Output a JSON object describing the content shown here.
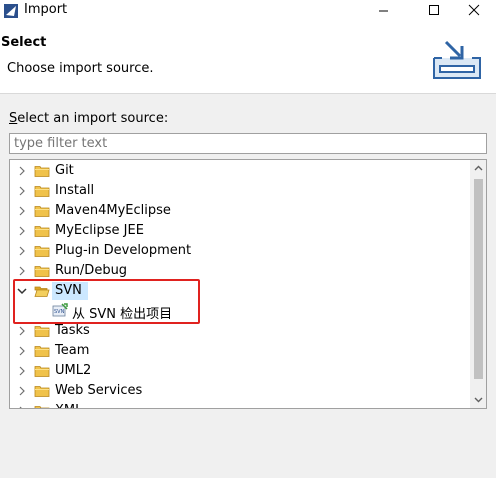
{
  "window": {
    "title": "Import",
    "icon": "eclipse-app-icon"
  },
  "header": {
    "title": "Select",
    "message": "Choose import source.",
    "art_icon": "import-tray-icon"
  },
  "source": {
    "label_prefix": "S",
    "label_rest": "elect an import source:",
    "filter_placeholder": "type filter text"
  },
  "tree": {
    "items": [
      {
        "label": "Git",
        "expanded": false
      },
      {
        "label": "Install",
        "expanded": false
      },
      {
        "label": "Maven4MyEclipse",
        "expanded": false
      },
      {
        "label": "MyEclipse JEE",
        "expanded": false
      },
      {
        "label": "Plug-in Development",
        "expanded": false
      },
      {
        "label": "Run/Debug",
        "expanded": false
      },
      {
        "label": "SVN",
        "expanded": true,
        "selected": true,
        "children": [
          {
            "label": "从 SVN 检出项目",
            "icon": "svn-checkout-icon"
          }
        ]
      },
      {
        "label": "Tasks",
        "expanded": false
      },
      {
        "label": "Team",
        "expanded": false
      },
      {
        "label": "UML2",
        "expanded": false
      },
      {
        "label": "Web Services",
        "expanded": false
      },
      {
        "label": "XML",
        "expanded": false
      }
    ]
  },
  "colors": {
    "selection": "#cce8ff",
    "highlight_box": "#e0221f",
    "folder": "#e8b93a"
  }
}
